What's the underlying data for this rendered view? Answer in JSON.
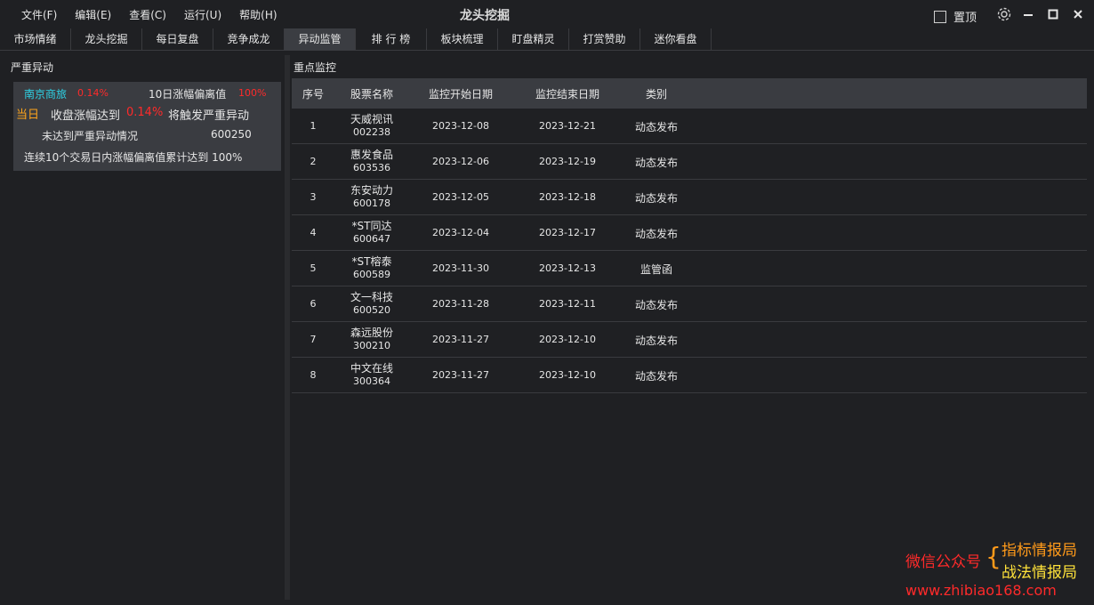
{
  "menu": [
    "文件(F)",
    "编辑(E)",
    "查看(C)",
    "运行(U)",
    "帮助(H)"
  ],
  "app_title": "龙头挖掘",
  "pin_label": "置顶",
  "tabs": [
    "市场情绪",
    "龙头挖掘",
    "每日复盘",
    "竞争成龙",
    "异动监管",
    "排 行 榜",
    "板块梳理",
    "盯盘精灵",
    "打赏赞助",
    "迷你看盘"
  ],
  "active_tab": "异动监管",
  "left": {
    "title": "严重异动",
    "stock_name": "南京商旅",
    "stock_pct": "0.14%",
    "dev_label": "10日涨幅偏离值",
    "dev_value": "100%",
    "today": "当日",
    "close_text": "收盘涨幅达到",
    "close_pct": "0.14%",
    "trigger_text": "将触发严重异动",
    "not_reached": "未达到严重异动情况",
    "code": "600250",
    "footer": "连续10个交易日内涨幅偏离值累计达到 100%"
  },
  "right": {
    "title": "重点监控",
    "headers": [
      "序号",
      "股票名称",
      "监控开始日期",
      "监控结束日期",
      "类别"
    ],
    "rows": [
      {
        "num": "1",
        "name": "天威视讯",
        "code": "002238",
        "start": "2023-12-08",
        "end": "2023-12-21",
        "type": "动态发布"
      },
      {
        "num": "2",
        "name": "惠发食品",
        "code": "603536",
        "start": "2023-12-06",
        "end": "2023-12-19",
        "type": "动态发布"
      },
      {
        "num": "3",
        "name": "东安动力",
        "code": "600178",
        "start": "2023-12-05",
        "end": "2023-12-18",
        "type": "动态发布"
      },
      {
        "num": "4",
        "name": "*ST同达",
        "code": "600647",
        "start": "2023-12-04",
        "end": "2023-12-17",
        "type": "动态发布"
      },
      {
        "num": "5",
        "name": "*ST榕泰",
        "code": "600589",
        "start": "2023-11-30",
        "end": "2023-12-13",
        "type": "监管函"
      },
      {
        "num": "6",
        "name": "文一科技",
        "code": "600520",
        "start": "2023-11-28",
        "end": "2023-12-11",
        "type": "动态发布"
      },
      {
        "num": "7",
        "name": "森远股份",
        "code": "300210",
        "start": "2023-11-27",
        "end": "2023-12-10",
        "type": "动态发布"
      },
      {
        "num": "8",
        "name": "中文在线",
        "code": "300364",
        "start": "2023-11-27",
        "end": "2023-12-10",
        "type": "动态发布"
      }
    ]
  },
  "watermark": {
    "wechat": "微信公众号",
    "line1": "指标情报局",
    "line2": "战法情报局",
    "url": "www.zhibiao168.com"
  },
  "icons": [
    "gear-icon",
    "minimize-icon",
    "maximize-icon",
    "close-icon"
  ],
  "colors": {
    "accent_cyan": "#2ed3e6",
    "red": "#ff2a2a",
    "orange": "#ffa41b",
    "watermark_red": "#ff2a2a",
    "watermark_orange": "#ff9a1a",
    "watermark_yellow": "#ffe23a"
  }
}
